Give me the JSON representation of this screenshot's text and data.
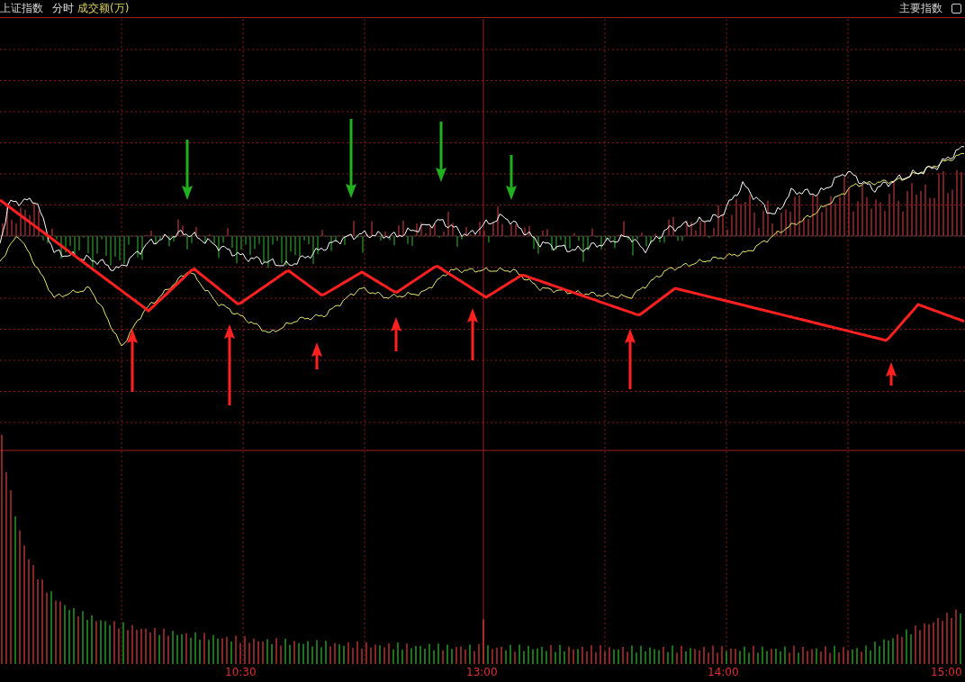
{
  "header": {
    "title": "上证指数",
    "mode": "分时",
    "indicator": "成交额(万)",
    "right_label": "主要指数"
  },
  "time_axis": {
    "labels": [
      "10:30",
      "13:00",
      "14:00",
      "15:00"
    ]
  }
}
